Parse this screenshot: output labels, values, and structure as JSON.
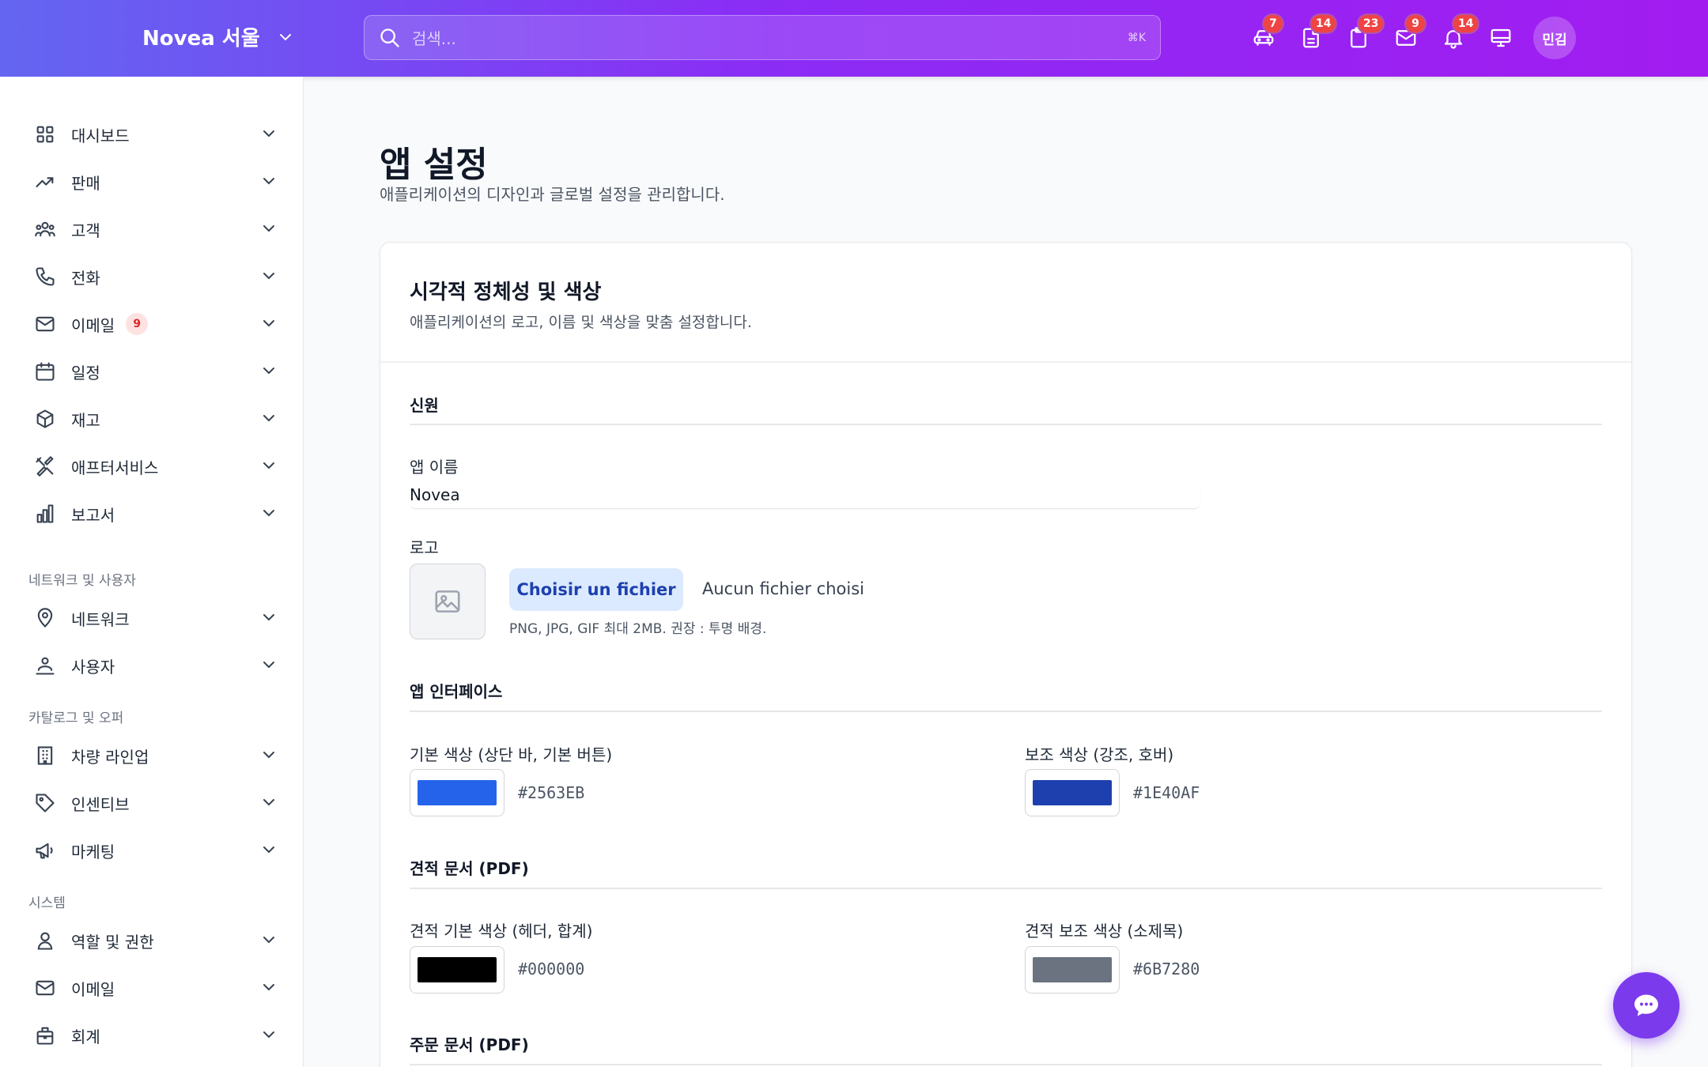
{
  "header": {
    "brand": "Novea 서울",
    "search_placeholder": "검색...",
    "search_shortcut": "⌘K",
    "icons": [
      {
        "name": "car-icon",
        "badge": "7"
      },
      {
        "name": "document-icon",
        "badge": "14"
      },
      {
        "name": "clipboard-icon",
        "badge": "23"
      },
      {
        "name": "mail-icon",
        "badge": "9"
      },
      {
        "name": "bell-icon",
        "badge": "14"
      },
      {
        "name": "monitor-icon",
        "badge": ""
      }
    ],
    "avatar_initials": "민김"
  },
  "sidebar": {
    "main_items": [
      {
        "label": "대시보드",
        "icon": "grid-icon"
      },
      {
        "label": "판매",
        "icon": "trending-up-icon"
      },
      {
        "label": "고객",
        "icon": "users-icon"
      },
      {
        "label": "전화",
        "icon": "phone-icon"
      },
      {
        "label": "이메일",
        "icon": "mail-icon",
        "badge": "9"
      },
      {
        "label": "일정",
        "icon": "calendar-icon"
      },
      {
        "label": "재고",
        "icon": "box-icon"
      },
      {
        "label": "애프터서비스",
        "icon": "tools-icon"
      },
      {
        "label": "보고서",
        "icon": "bar-chart-icon"
      }
    ],
    "section_network": "네트워크 및 사용자",
    "network_items": [
      {
        "label": "네트워크",
        "icon": "map-pin-icon"
      },
      {
        "label": "사용자",
        "icon": "user-group-icon"
      }
    ],
    "section_catalog": "카탈로그 및 오퍼",
    "catalog_items": [
      {
        "label": "차량 라인업",
        "icon": "building-icon"
      },
      {
        "label": "인센티브",
        "icon": "tag-icon"
      },
      {
        "label": "마케팅",
        "icon": "megaphone-icon"
      }
    ],
    "section_system": "시스템",
    "system_items": [
      {
        "label": "역할 및 권한",
        "icon": "user-icon"
      },
      {
        "label": "이메일",
        "icon": "mail-icon"
      },
      {
        "label": "회계",
        "icon": "briefcase-icon"
      }
    ]
  },
  "page": {
    "title": "앱 설정",
    "subtitle": "애플리케이션의 디자인과 글로벌 설정을 관리합니다."
  },
  "card": {
    "title": "시각적 정체성 및 색상",
    "subtitle": "애플리케이션의 로고, 이름 및 색상을 맞춤 설정합니다.",
    "identity_heading": "신원",
    "app_name_label": "앱 이름",
    "app_name_value": "Novea",
    "logo_label": "로고",
    "file_button": "Choisir un fichier",
    "file_status": "Aucun fichier choisi",
    "file_hint": "PNG, JPG, GIF 최대 2MB. 권장 : 투명 배경.",
    "interface_heading": "앱 인터페이스",
    "primary_label": "기본 색상 (상단 바, 기본 버튼)",
    "primary_hex": "#2563EB",
    "secondary_label": "보조 색상 (강조, 호버)",
    "secondary_hex": "#1E40AF",
    "quote_heading": "견적 문서 (PDF)",
    "quote_primary_label": "견적 기본 색상 (헤더, 합계)",
    "quote_primary_hex": "#000000",
    "quote_secondary_label": "견적 보조 색상 (소제목)",
    "quote_secondary_hex": "#6B7280",
    "order_heading": "주문 문서 (PDF)"
  },
  "colors": {
    "primary": "#2563EB",
    "secondary": "#1E40AF",
    "quote_primary": "#000000",
    "quote_secondary": "#6B7280"
  }
}
